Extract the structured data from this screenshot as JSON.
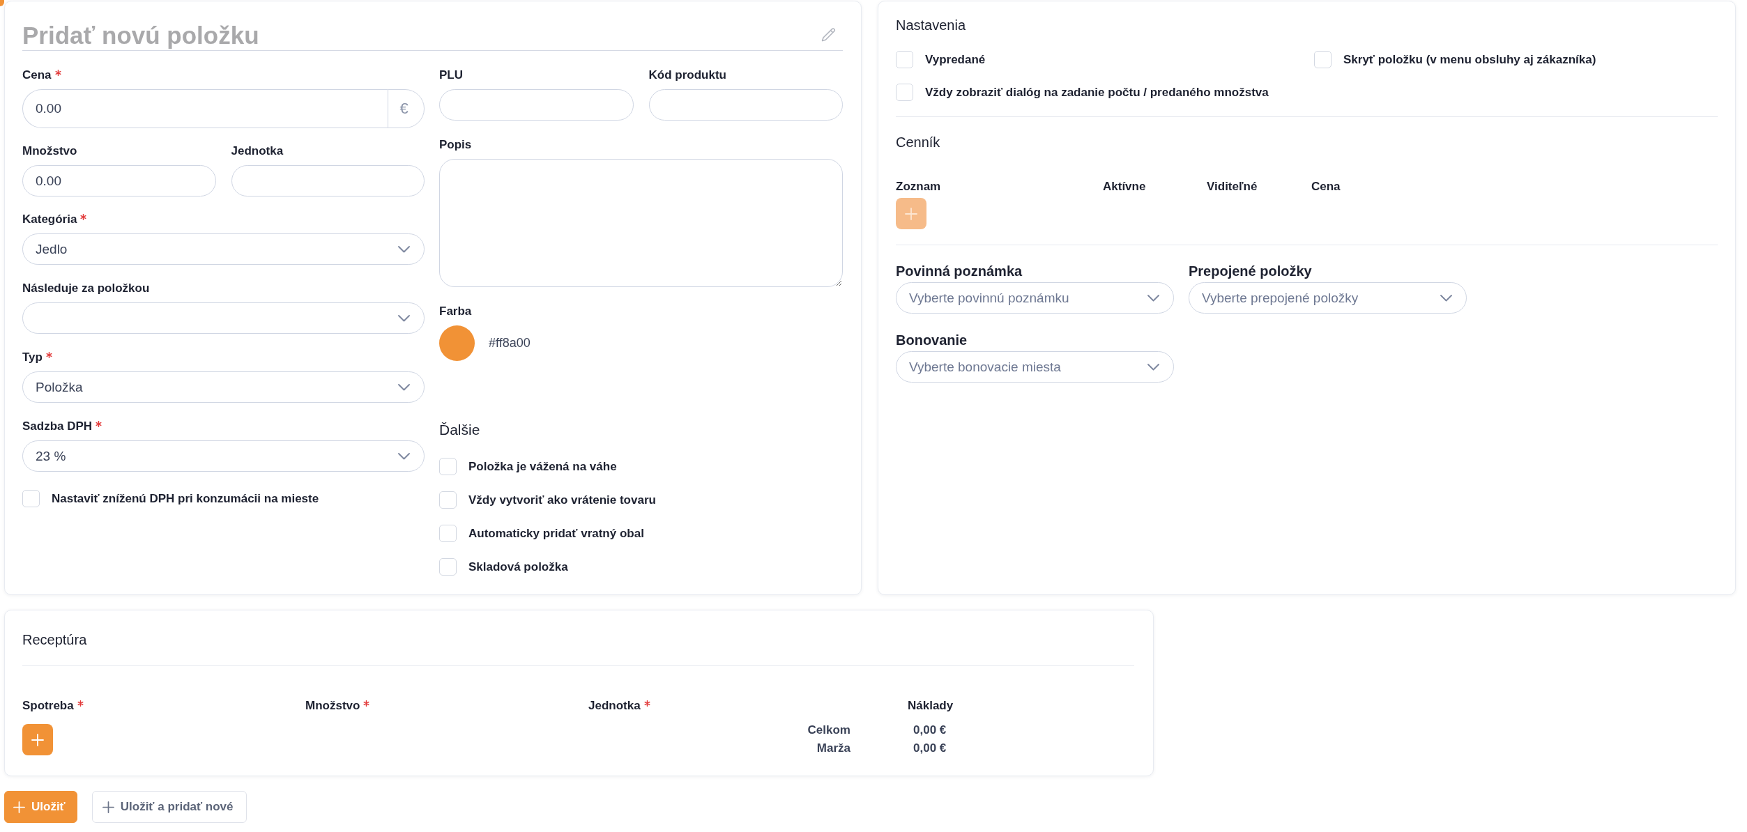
{
  "item_form": {
    "title": "Pridať novú položku",
    "price": {
      "label": "Cena",
      "required": true,
      "value": "0.00",
      "currency": "€"
    },
    "plu": {
      "label": "PLU",
      "required": false
    },
    "product_code": {
      "label": "Kód produktu",
      "required": false
    },
    "quantity": {
      "label": "Množstvo",
      "required": false,
      "value": "0.00"
    },
    "unit": {
      "label": "Jednotka",
      "required": false
    },
    "description": {
      "label": "Popis",
      "required": false
    },
    "category": {
      "label": "Kategória",
      "required": true,
      "value": "Jedlo"
    },
    "follows_item": {
      "label": "Následuje za položkou",
      "required": false
    },
    "color": {
      "label": "Farba",
      "value": "#ff8a00",
      "color": "#f19236"
    },
    "type": {
      "label": "Typ",
      "required": true,
      "value": "Položka"
    },
    "vat_rate": {
      "label": "Sadzba DPH",
      "required": true,
      "value": "23 %"
    },
    "reduced_vat": {
      "label": "Nastaviť zníženú DPH pri konzumácii na mieste",
      "checked": false
    },
    "more": {
      "title": "Ďalšie",
      "options": [
        {
          "label": "Položka je vážená na váhe",
          "checked": false
        },
        {
          "label": "Vždy vytvoriť ako vrátenie tovaru",
          "checked": false
        },
        {
          "label": "Automaticky pridať vratný obal",
          "checked": false
        },
        {
          "label": "Skladová položka",
          "checked": false
        }
      ]
    }
  },
  "settings_panel": {
    "title": "Nastavenia",
    "options": [
      {
        "label": "Vypredané",
        "checked": false
      },
      {
        "label": "Skryť položku (v menu obsluhy aj zákazníka)",
        "checked": false
      },
      {
        "label": "Vždy zobraziť dialóg na zadanie počtu / predaného množstva",
        "checked": false
      }
    ],
    "price_list": {
      "title": "Cenník",
      "columns": [
        "Zoznam",
        "Aktívne",
        "Viditeľné",
        "Cena"
      ],
      "add_button": {
        "disabled": true
      }
    },
    "required_note": {
      "label": "Povinná poznámka",
      "placeholder": "Vyberte povinnú poznámku"
    },
    "linked_items": {
      "label": "Prepojené položky",
      "placeholder": "Vyberte prepojené položky"
    },
    "printing": {
      "label": "Bonovanie",
      "placeholder": "Vyberte bonovacie miesta"
    }
  },
  "recipe": {
    "title": "Receptúra",
    "columns": [
      {
        "label": "Spotreba",
        "required": true
      },
      {
        "label": "Množstvo",
        "required": true
      },
      {
        "label": "Jednotka",
        "required": true
      },
      {
        "label": "Náklady",
        "required": false
      }
    ],
    "add_button": {
      "disabled": false
    },
    "totals": [
      {
        "label": "Celkom",
        "value": "0,00 €"
      },
      {
        "label": "Marža",
        "value": "0,00 €"
      }
    ]
  },
  "actions": [
    {
      "label": "Uložiť",
      "kind": "primary"
    },
    {
      "label": "Uložiť a pridať nové",
      "kind": "secondary"
    }
  ]
}
